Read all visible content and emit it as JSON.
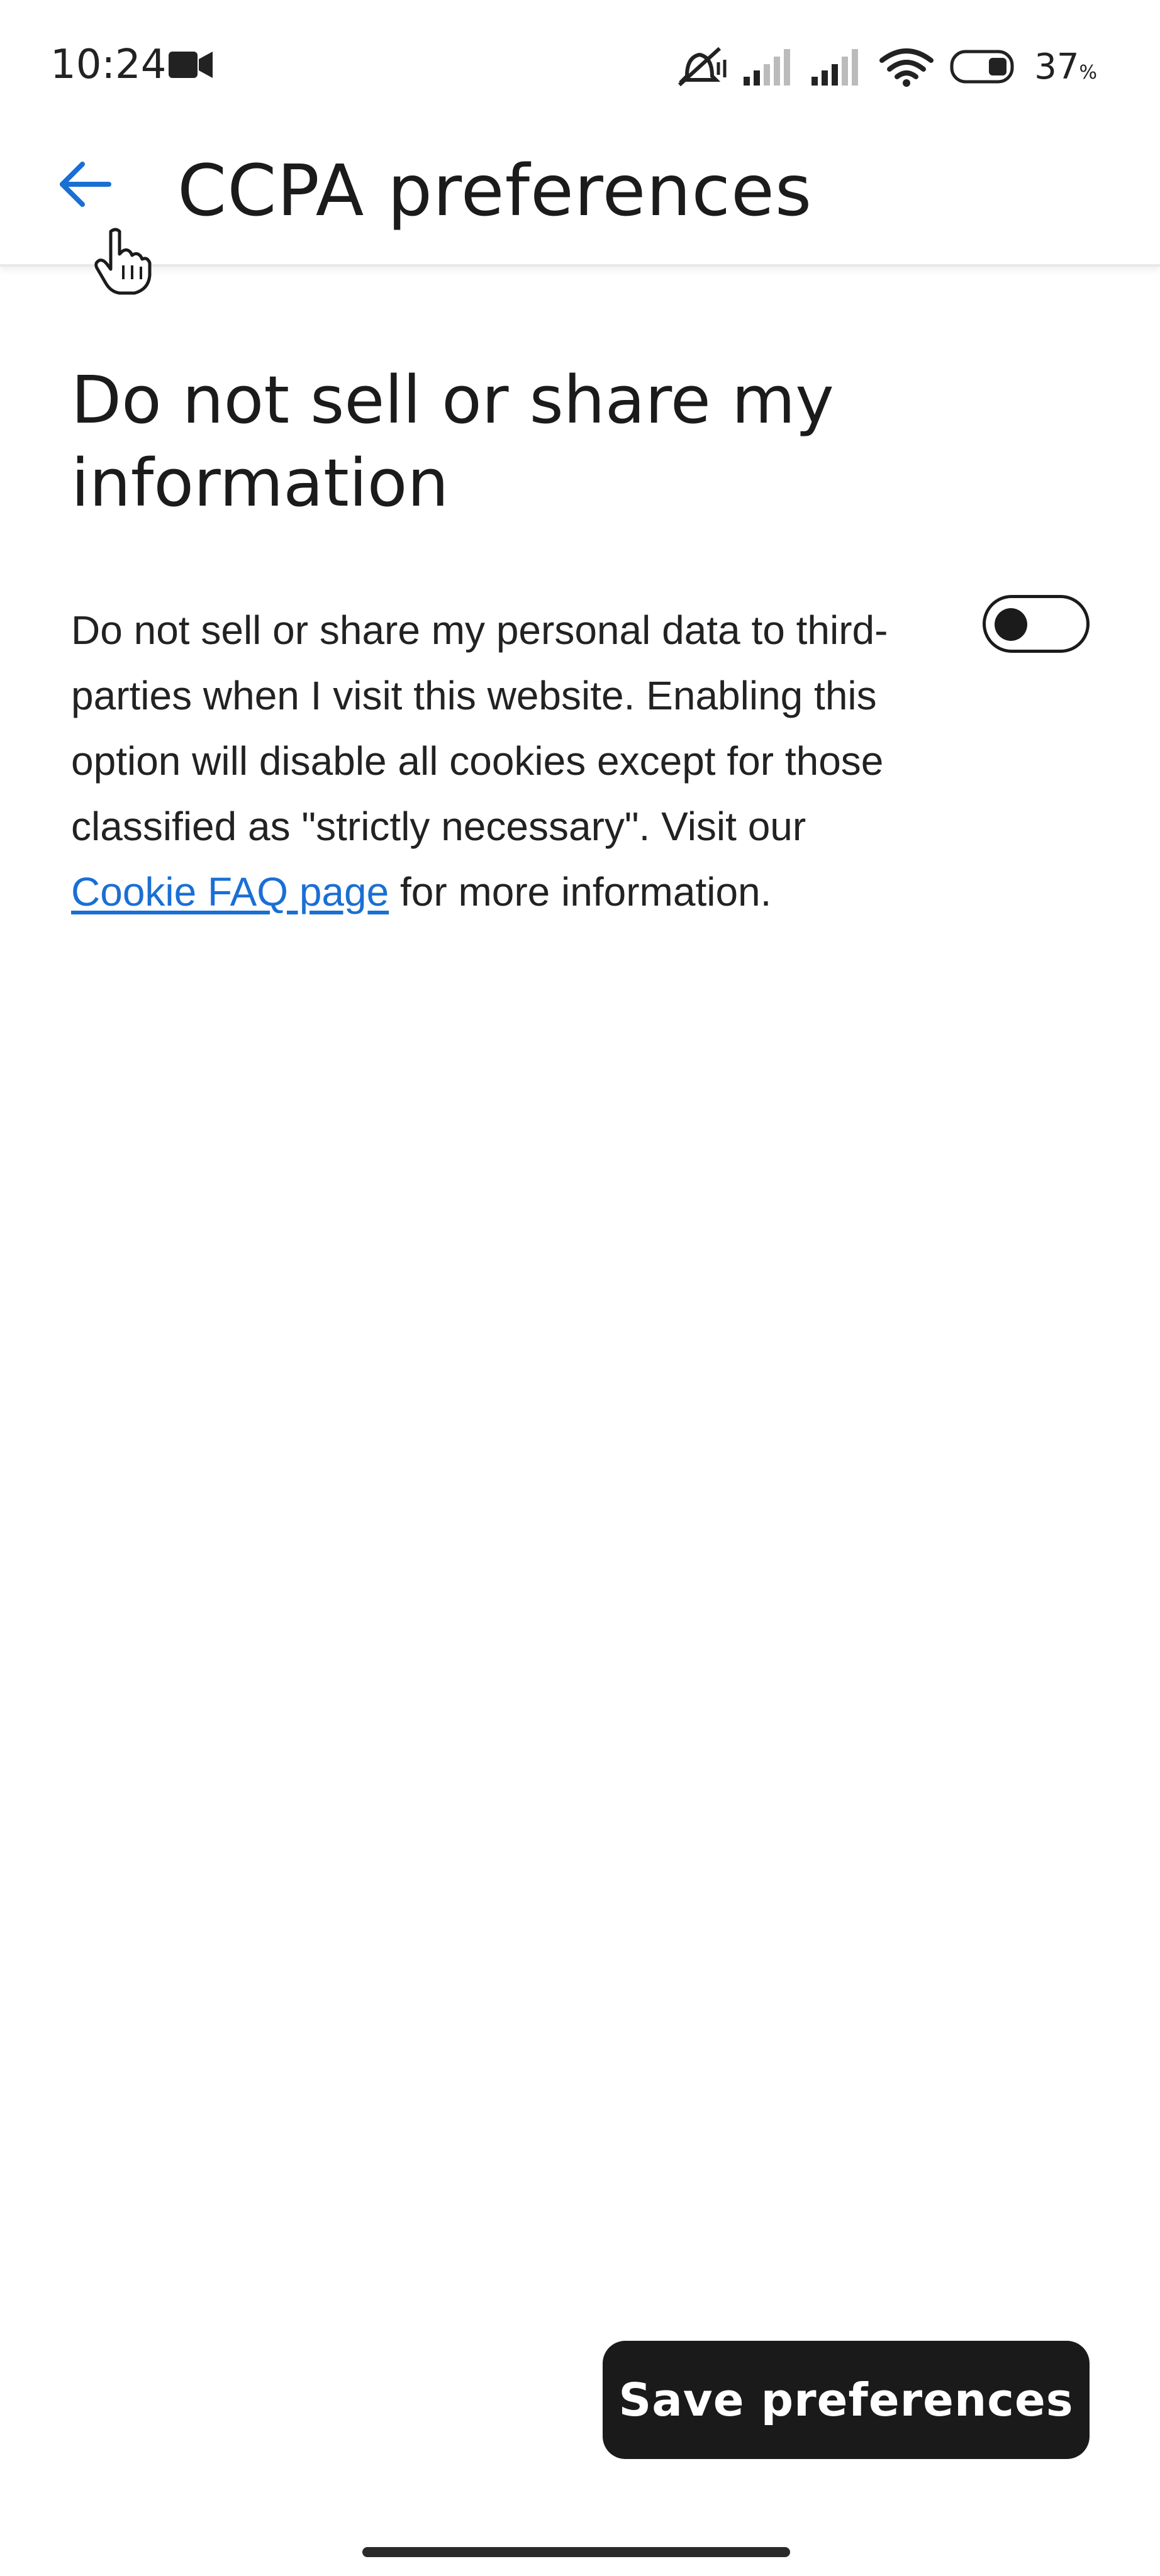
{
  "status_bar": {
    "time": "10:24",
    "battery_percent": "37",
    "battery_percent_symbol": "%",
    "icons": [
      "video-camera-icon",
      "mute-vibrate-icon",
      "signal-1-icon",
      "signal-2-icon",
      "wifi-icon",
      "battery-icon"
    ]
  },
  "app_bar": {
    "back_icon": "arrow-left-icon",
    "title": "CCPA preferences"
  },
  "section": {
    "heading": "Do not sell or share my information",
    "description_before_link": "Do not sell or share my personal data to third-parties when I visit this website. Enabling this option will disable all cookies except for those classified as \"strictly necessary\". Visit our ",
    "link_text": "Cookie FAQ page",
    "description_after_link": " for more information.",
    "toggle_on": false
  },
  "footer": {
    "save_label": "Save preferences"
  },
  "colors": {
    "accent": "#1a6fd4",
    "button_bg": "#1a1a1a",
    "text": "#1b1b1b"
  }
}
